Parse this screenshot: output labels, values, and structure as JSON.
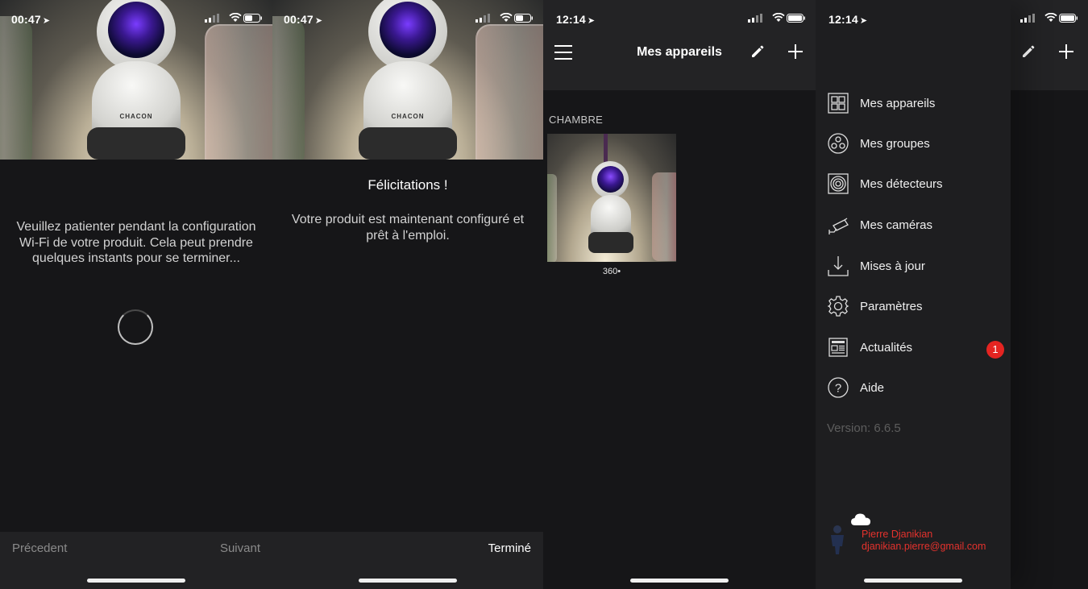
{
  "screens": {
    "wait": {
      "time": "00:47",
      "message": "Veuillez patienter pendant la configuration Wi-Fi de votre produit. Cela peut prendre quelques instants pour se terminer...",
      "prev_label": "Précedent",
      "next_label": "Suivant"
    },
    "done": {
      "time": "00:47",
      "title": "Félicitations !",
      "message": "Votre produit est maintenant configuré et prêt à l'emploi.",
      "done_label": "Terminé"
    },
    "devices": {
      "time": "12:14",
      "title": "Mes appareils",
      "section": "CHAMBRE",
      "device_name": "360•"
    },
    "menu": {
      "time": "12:14",
      "items": [
        {
          "label": "Mes appareils",
          "icon": "grid-icon"
        },
        {
          "label": "Mes groupes",
          "icon": "groups-icon"
        },
        {
          "label": "Mes détecteurs",
          "icon": "detector-icon"
        },
        {
          "label": "Mes caméras",
          "icon": "camera-icon"
        },
        {
          "label": "Mises à jour",
          "icon": "download-icon"
        },
        {
          "label": "Paramètres",
          "icon": "gear-icon"
        },
        {
          "label": "Actualités",
          "icon": "news-icon",
          "badge": "1"
        },
        {
          "label": "Aide",
          "icon": "help-icon"
        }
      ],
      "version": "Version: 6.6.5",
      "user_name": "Pierre Djanikian",
      "user_email": "djanikian.pierre@gmail.com"
    }
  },
  "camera_brand": "CHACON",
  "colors": {
    "accent_red": "#e52421",
    "background": "#161618",
    "bar": "#232325"
  }
}
